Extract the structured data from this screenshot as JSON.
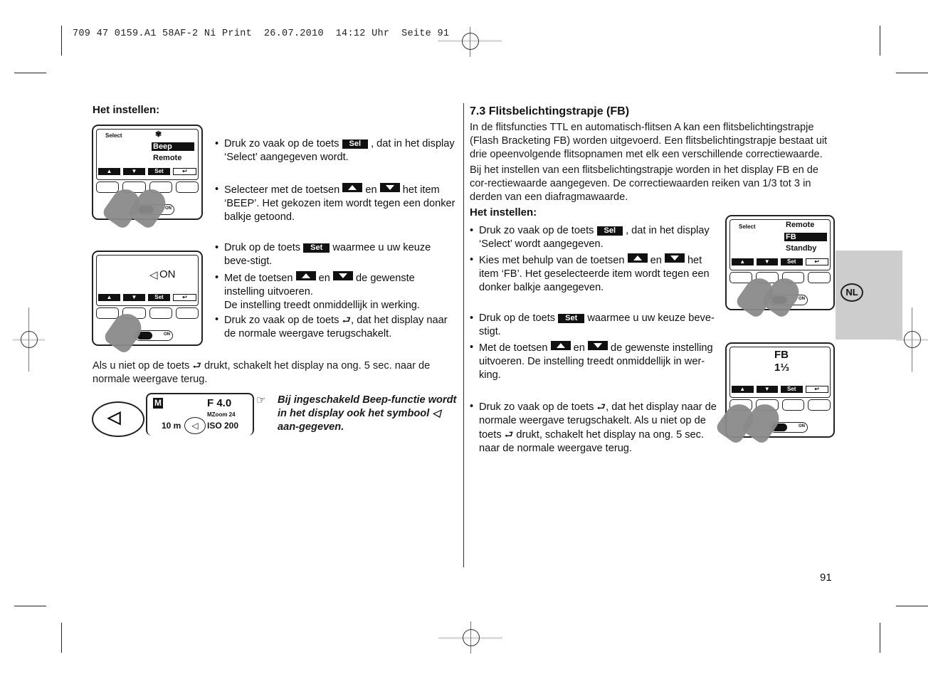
{
  "print_slug": "709 47 0159.A1 58AF-2 Ni Print  26.07.2010  14:12 Uhr  Seite 91",
  "left": {
    "heading": "Het instellen:",
    "display1": {
      "label": "Select",
      "icon": "flash-mode-icon",
      "items": [
        "Beep",
        "Remote"
      ],
      "selected": "Beep"
    },
    "softkeys": {
      "up": "▲",
      "down": "▼",
      "set": "Set",
      "return": "↩"
    },
    "switch_label": "ON",
    "bullets1": [
      {
        "pre": "Druk zo vaak op de toets",
        "key": "Sel",
        "post": ", dat in het display ‘Select’  aangegeven wordt."
      },
      {
        "pre": "Selecteer met de toetsen",
        "mid": "en",
        "post": "het item ‘BEEP’. Het gekozen item wordt tegen een donker balkje getoond."
      }
    ],
    "display2": {
      "value": "ON",
      "icon": "speaker-icon"
    },
    "bullets2": [
      {
        "pre": "Druk op de toets",
        "key": "Set",
        "post": "waarmee u uw keuze beve-stigt."
      },
      {
        "pre": "Met de toetsen",
        "mid": "en",
        "post": "de gewenste instelling uitvoeren.",
        "extra": "De instelling treedt onmiddellijk in werking."
      },
      {
        "pre": "Druk zo vaak op de toets",
        "post": ", dat het display naar de normale weergave terugschakelt."
      }
    ],
    "note_pre": "Als u niet op de toets",
    "note_post": "drukt, schakelt het display na ong. 5 sec. naar de normale weergave terug.",
    "lcd": {
      "mode": "M",
      "aperture": "F 4.0",
      "zoom": "MZoom  24",
      "distance": "10 m",
      "iso": "ISO 200"
    },
    "tip": "Bij ingeschakeld Beep-functie wordt in het display ook het symbool ◁ aan-gegeven."
  },
  "right": {
    "heading": "7.3 Flitsbelichtingstrapje (FB)",
    "para1": "In de flitsfuncties TTL en automatisch-flitsen A kan een flitsbelichtingstrapje (Flash Bracketing FB) worden uitgevoerd. Een flitsbelichtingstrapje bestaat uit drie opeenvolgende flitsopnamen met elk een verschillende correctiewaarde.",
    "para2": "Bij het instellen van een flitsbelichtingstrapje worden in het display FB en de cor-rectiewaarde aangegeven. De correctiewaarden reiken van 1/3 tot 3 in derden van een diafragmawaarde.",
    "subheading": "Het instellen:",
    "display1": {
      "label": "Select",
      "items": [
        "Remote",
        "FB",
        "Standby"
      ],
      "selected": "FB"
    },
    "bullets1": [
      {
        "pre": "Druk zo vaak op de toets",
        "key": "Sel",
        "post": ", dat in het display ‘Select’  wordt aangegeven."
      },
      {
        "pre": "Kies met behulp van de toetsen",
        "mid": "en",
        "post": "het item ‘FB’. Het geselecteerde item wordt tegen een donker balkje aangegeven."
      }
    ],
    "display2": {
      "line1": "FB",
      "line2": "1⅓"
    },
    "bullets2": [
      {
        "pre": "Druk op de toets",
        "key": "Set",
        "post": "waarmee u uw keuze beve-stigt."
      },
      {
        "pre": "Met de toetsen",
        "mid": "en",
        "post": "de gewenste instelling uitvoeren. De instelling treedt onmiddellijk in wer-king."
      },
      {
        "pre": "Druk zo vaak op de toets",
        "post": ", dat het display naar de normale weergave terugschakelt. Als u niet op de toets",
        "post2": "drukt, schakelt het display na ong. 5 sec. naar de normale weergave terug."
      }
    ]
  },
  "language_tab": "NL",
  "page_number": "91"
}
